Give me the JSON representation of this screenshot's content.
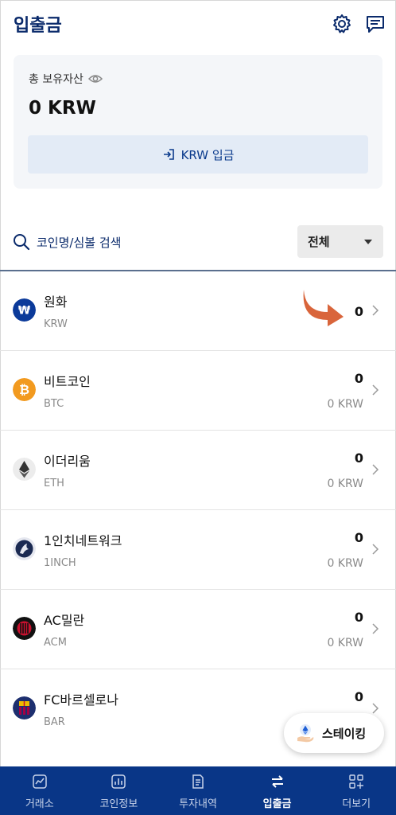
{
  "header": {
    "title": "입출금"
  },
  "asset": {
    "label": "총 보유자산",
    "value": "0 KRW",
    "deposit_button": "KRW 입금"
  },
  "search": {
    "placeholder": "코인명/심볼 검색"
  },
  "filter": {
    "selected": "전체"
  },
  "coins": [
    {
      "name": "원화",
      "symbol": "KRW",
      "amount": "0",
      "krw": ""
    },
    {
      "name": "비트코인",
      "symbol": "BTC",
      "amount": "0",
      "krw": "0 KRW"
    },
    {
      "name": "이더리움",
      "symbol": "ETH",
      "amount": "0",
      "krw": "0 KRW"
    },
    {
      "name": "1인치네트워크",
      "symbol": "1INCH",
      "amount": "0",
      "krw": "0 KRW"
    },
    {
      "name": "AC밀란",
      "symbol": "ACM",
      "amount": "0",
      "krw": "0 KRW"
    },
    {
      "name": "FC바르셀로나",
      "symbol": "BAR",
      "amount": "0",
      "krw": ""
    }
  ],
  "staking": {
    "label": "스테이킹"
  },
  "nav": [
    {
      "label": "거래소",
      "icon": "exchange-chart-icon"
    },
    {
      "label": "코인정보",
      "icon": "bar-chart-icon"
    },
    {
      "label": "투자내역",
      "icon": "document-icon"
    },
    {
      "label": "입출금",
      "icon": "transfer-arrows-icon"
    },
    {
      "label": "더보기",
      "icon": "more-grid-icon"
    }
  ],
  "colors": {
    "brand_navy": "#093687",
    "title_navy": "#0a2a6b",
    "annotation_arrow": "#d9653b"
  }
}
